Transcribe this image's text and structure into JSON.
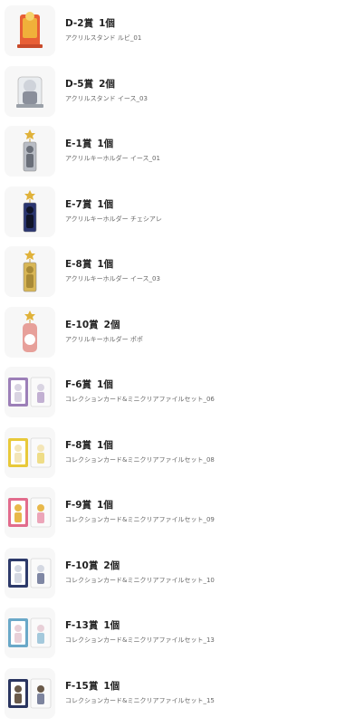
{
  "prizes": [
    {
      "prize": "D-2賞",
      "qty": "1個",
      "name": "アクリルスタンド ルビ_01",
      "kind": "stand",
      "colors": [
        "#e85f35",
        "#f0b03a"
      ]
    },
    {
      "prize": "D-5賞",
      "qty": "2個",
      "name": "アクリルスタンド イース_03",
      "kind": "stand2",
      "colors": [
        "#cfd3da",
        "#8a8f9b"
      ]
    },
    {
      "prize": "E-1賞",
      "qty": "1個",
      "name": "アクリルキーホルダー イース_01",
      "kind": "key",
      "colors": [
        "#b8bcc4",
        "#6a6f79"
      ]
    },
    {
      "prize": "E-7賞",
      "qty": "1個",
      "name": "アクリルキーホルダー チェシアレ",
      "kind": "key",
      "colors": [
        "#2a3570",
        "#101428"
      ]
    },
    {
      "prize": "E-8賞",
      "qty": "1個",
      "name": "アクリルキーホルダー イース_03",
      "kind": "key",
      "colors": [
        "#d8b656",
        "#a88a38"
      ]
    },
    {
      "prize": "E-10賞",
      "qty": "2個",
      "name": "アクリルキーホルダー ポポ",
      "kind": "keyround",
      "colors": [
        "#e7a09a",
        "#ffffff"
      ]
    },
    {
      "prize": "F-6賞",
      "qty": "1個",
      "name": "コレクションカード&ミニクリアファイルセット_06",
      "kind": "card",
      "colors": [
        "#9c7fb8",
        "#d9d4e2"
      ]
    },
    {
      "prize": "F-8賞",
      "qty": "1個",
      "name": "コレクションカード&ミニクリアファイルセット_08",
      "kind": "card",
      "colors": [
        "#e8c93a",
        "#f4e6b8"
      ]
    },
    {
      "prize": "F-9賞",
      "qty": "1個",
      "name": "コレクションカード&ミニクリアファイルセット_09",
      "kind": "card",
      "colors": [
        "#e26c8d",
        "#e8b84a"
      ]
    },
    {
      "prize": "F-10賞",
      "qty": "2個",
      "name": "コレクションカード&ミニクリアファイルセット_10",
      "kind": "card",
      "colors": [
        "#2d3a6a",
        "#d4d8e2"
      ]
    },
    {
      "prize": "F-13賞",
      "qty": "1個",
      "name": "コレクションカード&ミニクリアファイルセット_13",
      "kind": "card",
      "colors": [
        "#6aa8c8",
        "#e8d0d8"
      ]
    },
    {
      "prize": "F-15賞",
      "qty": "1個",
      "name": "コレクションカード&ミニクリアファイルセット_15",
      "kind": "card",
      "colors": [
        "#2a3560",
        "#6a5a4a"
      ]
    }
  ]
}
